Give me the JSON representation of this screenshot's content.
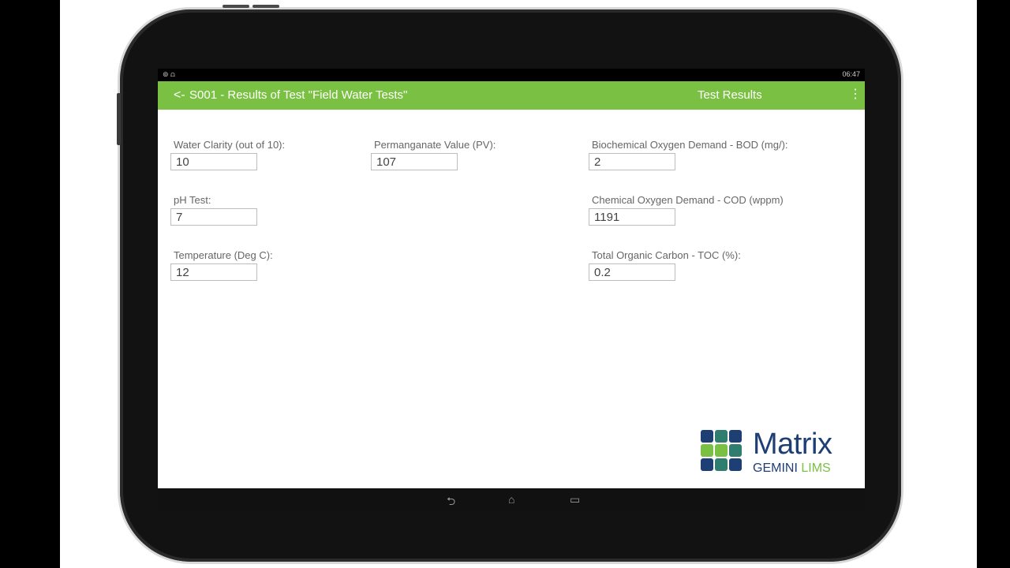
{
  "status_bar": {
    "left_icons": "⊚ ⩍",
    "right_text": "06:47"
  },
  "app_bar": {
    "back_symbol": "<-",
    "title": "S001 - Results of Test \"Field Water Tests\"",
    "section": "Test Results",
    "overflow_symbol": "⋮"
  },
  "fields": {
    "water_clarity": {
      "label": "Water Clarity (out of 10):",
      "value": "10"
    },
    "ph": {
      "label": "pH Test:",
      "value": "7"
    },
    "temperature": {
      "label": "Temperature (Deg C):",
      "value": "12"
    },
    "permanganate": {
      "label": "Permanganate Value (PV):",
      "value": "107"
    },
    "bod": {
      "label": "Biochemical Oxygen Demand - BOD (mg/):",
      "value": "2"
    },
    "cod": {
      "label": "Chemical Oxygen Demand - COD (wppm)",
      "value": "1191"
    },
    "toc": {
      "label": "Total Organic Carbon - TOC (%):",
      "value": "0.2"
    }
  },
  "logo": {
    "word": "Matrix",
    "sub_1": "GEMINI",
    "sub_2": "LIMS"
  },
  "nav_bar": {
    "back": "⮌",
    "home": "⌂",
    "recents": "▭"
  },
  "colors": {
    "accent": "#7ac143",
    "brand_navy": "#1e3f73"
  }
}
